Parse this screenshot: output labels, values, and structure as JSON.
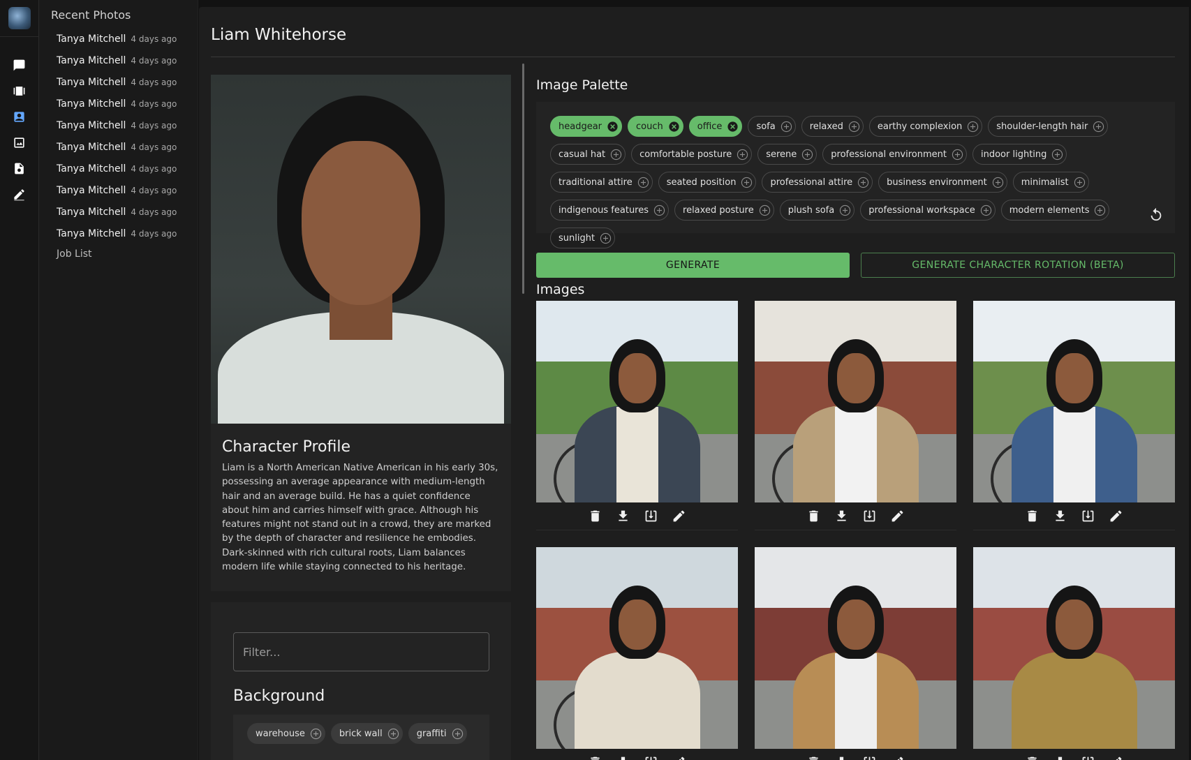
{
  "app": {
    "sidebar_title": "Recent Photos",
    "recent": [
      {
        "name": "Tanya Mitchell",
        "time": "4 days ago"
      },
      {
        "name": "Tanya Mitchell",
        "time": "4 days ago"
      },
      {
        "name": "Tanya Mitchell",
        "time": "4 days ago"
      },
      {
        "name": "Tanya Mitchell",
        "time": "4 days ago"
      },
      {
        "name": "Tanya Mitchell",
        "time": "4 days ago"
      },
      {
        "name": "Tanya Mitchell",
        "time": "4 days ago"
      },
      {
        "name": "Tanya Mitchell",
        "time": "4 days ago"
      },
      {
        "name": "Tanya Mitchell",
        "time": "4 days ago"
      },
      {
        "name": "Tanya Mitchell",
        "time": "4 days ago"
      },
      {
        "name": "Tanya Mitchell",
        "time": "4 days ago"
      }
    ],
    "job_list": "Job List",
    "nav_icons": [
      "chat-icon",
      "video-library-icon",
      "contact-card-icon",
      "image-search-icon",
      "document-icon",
      "edit-icon"
    ],
    "active_nav": "contact-card-icon"
  },
  "character": {
    "name": "Liam Whitehorse",
    "profile_title": "Character Profile",
    "profile_text": "Liam is a North American Native American in his early 30s, possessing an average appearance with medium-length hair and an average build. He has a quiet confidence about him and carries himself with grace. Although his features might not stand out in a crowd, they are marked by the depth of character and resilience he embodies. Dark-skinned with rich cultural roots, Liam balances modern life while staying connected to his heritage."
  },
  "filter": {
    "placeholder": "Filter...",
    "background_title": "Background",
    "background_chips": [
      "warehouse",
      "brick wall",
      "graffiti"
    ]
  },
  "palette": {
    "title": "Image Palette",
    "selected": [
      "headgear",
      "couch",
      "office"
    ],
    "chips": [
      "sofa",
      "relaxed",
      "earthy complexion",
      "shoulder-length hair",
      "casual hat",
      "comfortable posture",
      "serene",
      "professional environment",
      "indoor lighting",
      "traditional attire",
      "seated position",
      "professional attire",
      "business environment",
      "minimalist",
      "indigenous features",
      "relaxed posture",
      "plush sofa",
      "professional workspace",
      "modern elements",
      "sunlight"
    ]
  },
  "buttons": {
    "generate": "GENERATE",
    "rotation": "GENERATE CHARACTER ROTATION (BETA)"
  },
  "images": {
    "title": "Images",
    "actions": [
      "delete-icon",
      "download-icon",
      "save-to-library-icon",
      "edit-icon"
    ],
    "count": 6
  },
  "colors": {
    "accent": "#66bb6a",
    "active_nav": "#64a8ff",
    "panel": "#1e1e1e",
    "background": "#121212"
  }
}
